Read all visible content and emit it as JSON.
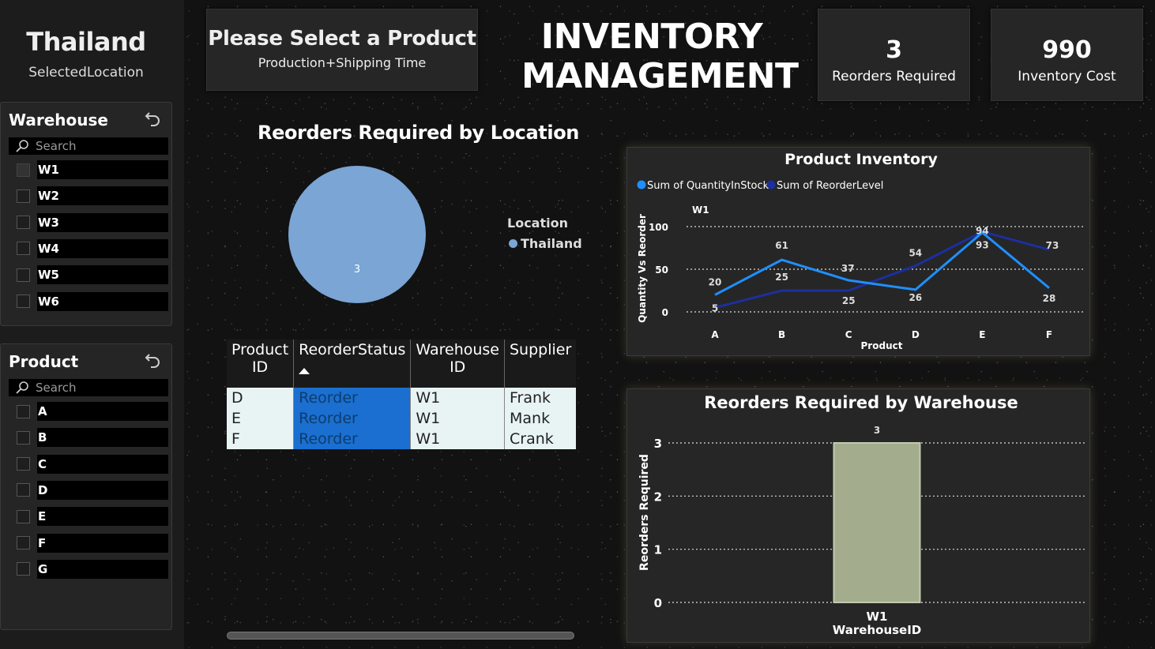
{
  "sidebar": {
    "location_value": "Thailand",
    "location_label": "SelectedLocation",
    "warehouse_slicer": {
      "title": "Warehouse",
      "search_placeholder": "Search",
      "items": [
        {
          "label": "W1",
          "checked": true
        },
        {
          "label": "W2",
          "checked": false
        },
        {
          "label": "W3",
          "checked": false
        },
        {
          "label": "W4",
          "checked": false
        },
        {
          "label": "W5",
          "checked": false
        },
        {
          "label": "W6",
          "checked": false
        }
      ]
    },
    "product_slicer": {
      "title": "Product",
      "search_placeholder": "Search",
      "items": [
        {
          "label": "A",
          "checked": false
        },
        {
          "label": "B",
          "checked": false
        },
        {
          "label": "C",
          "checked": false
        },
        {
          "label": "D",
          "checked": false
        },
        {
          "label": "E",
          "checked": false
        },
        {
          "label": "F",
          "checked": false
        },
        {
          "label": "G",
          "checked": false
        }
      ]
    }
  },
  "header": {
    "prompt_title": "Please Select a Product",
    "prompt_subtitle": "Production+Shipping Time",
    "title_line1": "INVENTORY",
    "title_line2": "MANAGEMENT"
  },
  "kpis": [
    {
      "value": "3",
      "label": "Reorders Required"
    },
    {
      "value": "990",
      "label": "Inventory Cost"
    }
  ],
  "pie": {
    "title": "Reorders Required by Location",
    "legend_title": "Location",
    "legend_item": "Thailand",
    "color": "#7aa5d4"
  },
  "table": {
    "headers": [
      "Product ID",
      "ReorderStatus",
      "Warehouse ID",
      "Supplier"
    ],
    "rows": [
      [
        "D",
        "Reorder",
        "W1",
        "Frank"
      ],
      [
        "E",
        "Reorder",
        "W1",
        "Mank"
      ],
      [
        "F",
        "Reorder",
        "W1",
        "Crank"
      ]
    ]
  },
  "chart_data": [
    {
      "type": "pie",
      "title": "Reorders Required by Location",
      "categories": [
        "Thailand"
      ],
      "values": [
        3
      ],
      "legend_title": "Location",
      "legend_position": "right"
    },
    {
      "type": "line",
      "title": "Product Inventory",
      "xlabel": "Product",
      "ylabel": "Quantity Vs Reorder",
      "facet_label": "W1",
      "categories": [
        "A",
        "B",
        "C",
        "D",
        "E",
        "F"
      ],
      "ylim": [
        0,
        100
      ],
      "yticks": [
        0,
        50,
        100
      ],
      "legend_position": "top-left",
      "grid": true,
      "series": [
        {
          "name": "Sum of QuantityInStock",
          "color": "#1f8fff",
          "values": [
            20,
            61,
            37,
            26,
            93,
            28
          ]
        },
        {
          "name": "Sum of ReorderLevel",
          "color": "#1c2f9e",
          "values": [
            5,
            25,
            25,
            54,
            94,
            73
          ]
        }
      ]
    },
    {
      "type": "bar",
      "title": "Reorders Required by Warehouse",
      "xlabel": "WarehouseID",
      "ylabel": "Reorders Required",
      "categories": [
        "W1"
      ],
      "values": [
        3
      ],
      "ylim": [
        0,
        3
      ],
      "yticks": [
        0,
        1,
        2,
        3
      ],
      "grid": true,
      "color": "#a3ad8e"
    }
  ]
}
